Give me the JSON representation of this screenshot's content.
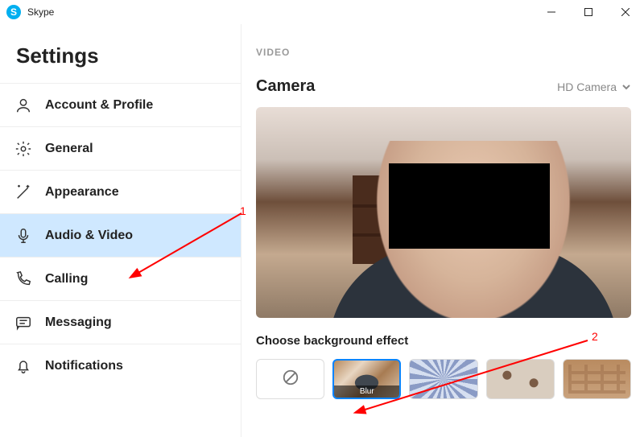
{
  "titlebar": {
    "app_name": "Skype"
  },
  "sidebar": {
    "heading": "Settings",
    "items": [
      {
        "label": "Account & Profile"
      },
      {
        "label": "General"
      },
      {
        "label": "Appearance"
      },
      {
        "label": "Audio & Video"
      },
      {
        "label": "Calling"
      },
      {
        "label": "Messaging"
      },
      {
        "label": "Notifications"
      }
    ]
  },
  "main": {
    "section_label": "VIDEO",
    "camera_heading": "Camera",
    "camera_selected": "HD Camera",
    "effect_heading": "Choose background effect",
    "effects": {
      "blur_label": "Blur"
    }
  },
  "annotations": {
    "n1": "1",
    "n2": "2"
  }
}
